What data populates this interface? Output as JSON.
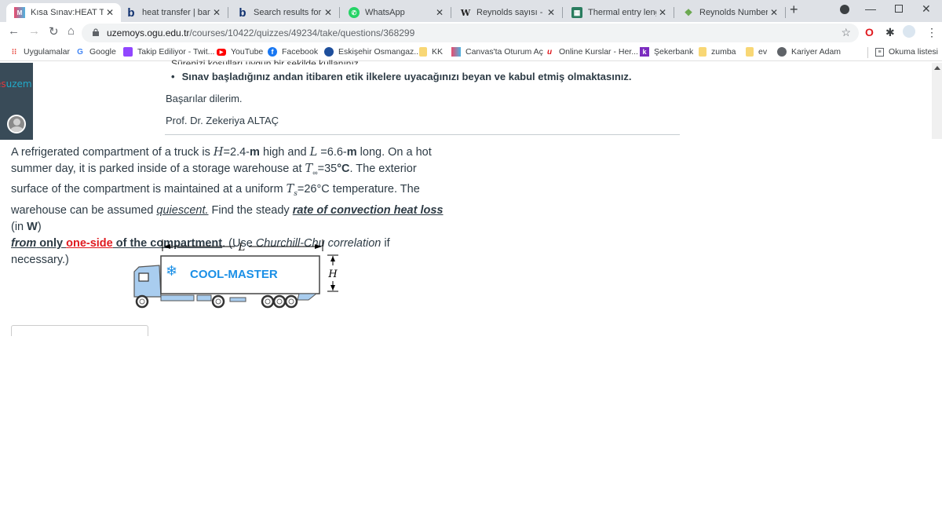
{
  "browser": {
    "tabs": [
      {
        "title": "Kısa Sınav:HEAT TRANS",
        "icon": "canvas-icon",
        "active": true
      },
      {
        "title": "heat transfer | bartleby",
        "icon": "bartleby-icon",
        "active": false
      },
      {
        "title": "Search results for 'hea",
        "icon": "bartleby-icon",
        "active": false
      },
      {
        "title": "WhatsApp",
        "icon": "whatsapp-icon",
        "active": false
      },
      {
        "title": "Reynolds sayısı - Vikip",
        "icon": "wikipedia-icon",
        "active": false
      },
      {
        "title": "Thermal entry length",
        "icon": "calculator-icon",
        "active": false
      },
      {
        "title": "Reynolds Number Calc",
        "icon": "reynolds-icon",
        "active": false
      }
    ],
    "new_tab_label": "+",
    "url_host": "uzemoys.ogu.edu.tr",
    "url_path": "/courses/10422/quizzes/49234/take/questions/368299",
    "bookmarks": [
      {
        "label": "Uygulamalar",
        "icon": "apps-grid-icon"
      },
      {
        "label": "Google",
        "icon": "google-icon"
      },
      {
        "label": "Takip Ediliyor - Twit...",
        "icon": "twitch-icon"
      },
      {
        "label": "YouTube",
        "icon": "youtube-icon"
      },
      {
        "label": "Facebook",
        "icon": "facebook-icon"
      },
      {
        "label": "Eskişehir Osmangaz...",
        "icon": "university-icon"
      },
      {
        "label": "KK",
        "icon": "folder-icon"
      },
      {
        "label": "Canvas'ta Oturum Aç",
        "icon": "canvas-icon"
      },
      {
        "label": "Online Kurslar - Her...",
        "icon": "udemy-icon"
      },
      {
        "label": "Şekerbank",
        "icon": "sekerbank-icon"
      },
      {
        "label": "zumba",
        "icon": "folder-icon"
      },
      {
        "label": "ev",
        "icon": "folder-icon"
      },
      {
        "label": "Kariyer Adam",
        "icon": "globe-icon"
      }
    ],
    "reading_list_label": "Okuma listesi"
  },
  "sidebar": {
    "logo_red": "es",
    "logo_blue": "uzem"
  },
  "instructions": {
    "cut_line": "Sürenizi koşulları uygun bir şekilde kullanınız.",
    "bullet": "Sınav başladığınız andan itibaren etik ilkelere uyacağınızı beyan ve kabul etmiş olmaktasınız.",
    "wishes": "Başarılar dilerim.",
    "signature": "Prof. Dr. Zekeriya ALTAÇ"
  },
  "question": {
    "p1": "A refrigerated compartment of a truck is ",
    "H_sym": "H",
    "H_val": "=2.4-",
    "m1": "m",
    "p2": " high and ",
    "L_sym": "L",
    "L_val": " =6.6-",
    "m2": "m",
    "p3": " long. On a hot summer day, it is parked inside of a storage warehouse at ",
    "Tinf_sym": "T",
    "Tinf_sub": "∞",
    "Tinf_val": "=35",
    "degC1": "°C",
    "p4": ". The exterior surface of the compartment is maintained at  a uniform ",
    "Ts_sym": "T",
    "Ts_sub": "s",
    "Ts_val": "=26",
    "degC2": "°C",
    "p5": " temperature. The warehouse can be assumed ",
    "quiescent": "quiescent.",
    "p6": " Find the steady ",
    "rate": "rate of convection heat loss",
    "p7": " (in ",
    "W": "W",
    "p8": ")",
    "from": "from",
    "only": " only ",
    "oneside": "one-side",
    "ofcomp": " of the compartment",
    "p9": ". (Use ",
    "cc": "Churchill-Chu correlation",
    "p10": " if necessary.)"
  },
  "figure": {
    "brand": "COOL-MASTER",
    "L_label": "L",
    "H_label": "H"
  }
}
